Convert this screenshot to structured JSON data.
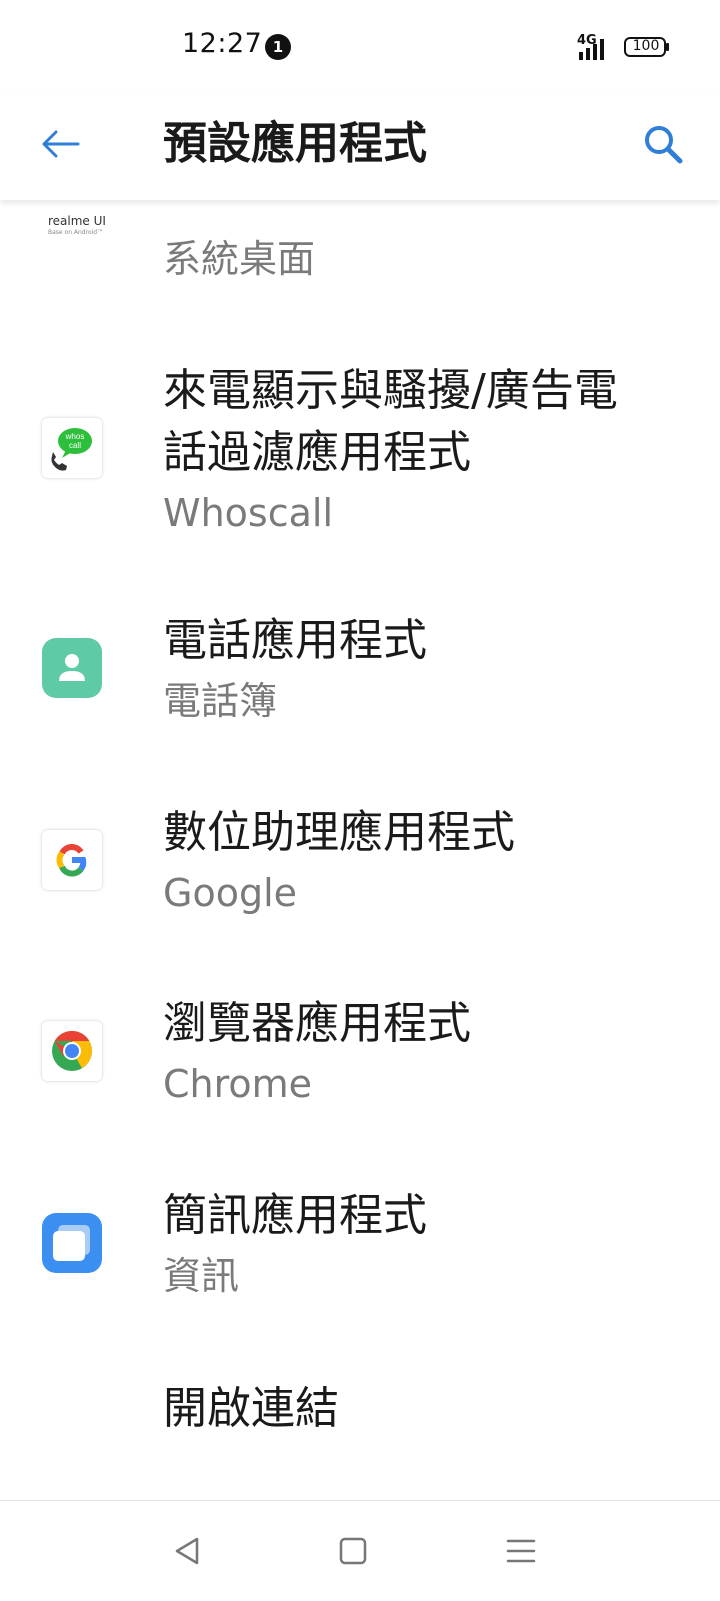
{
  "status_bar": {
    "time": "12:27",
    "notification_count": "1",
    "network_type": "4G",
    "battery_level": "100"
  },
  "app_bar": {
    "title": "預設應用程式"
  },
  "list": {
    "partial_item": {
      "logo_text": "realme UI",
      "logo_subtext": "Base on Android™",
      "subtitle": "系統桌面"
    },
    "items": [
      {
        "title_line1": "來電顯示與騷擾/廣告電",
        "title_line2": "話過濾應用程式",
        "subtitle": "Whoscall",
        "icon_text": "whos call"
      },
      {
        "title": "電話應用程式",
        "subtitle": "電話簿"
      },
      {
        "title": "數位助理應用程式",
        "subtitle": "Google"
      },
      {
        "title": "瀏覽器應用程式",
        "subtitle": "Chrome"
      },
      {
        "title": "簡訊應用程式",
        "subtitle": "資訊"
      },
      {
        "title": "開啟連結"
      }
    ]
  },
  "colors": {
    "accent": "#2f7fd8",
    "whoscall_green": "#2dbf3b",
    "contacts_teal": "#5ecba6",
    "messages_blue": "#3a8ff0"
  }
}
